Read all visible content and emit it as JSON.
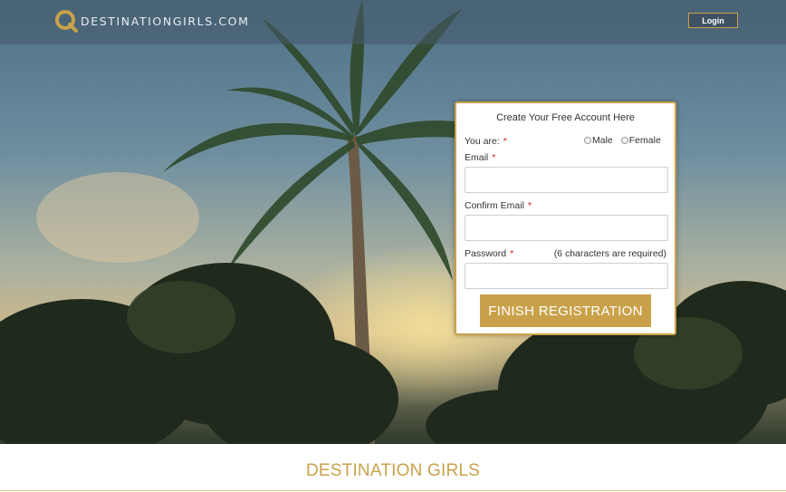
{
  "header": {
    "logo_text": "DESTINATIONGIRLS.COM",
    "login_label": "Login"
  },
  "form": {
    "title": "Create Your Free Account Here",
    "gender_label": "You are:",
    "gender_options": [
      "Male",
      "Female"
    ],
    "email_label": "Email",
    "confirm_email_label": "Confirm Email",
    "password_label": "Password",
    "password_note": "(6 characters are required)",
    "required_marker": "*",
    "email_value": "",
    "confirm_email_value": "",
    "password_value": "",
    "submit_label": "FINISH REGISTRATION"
  },
  "footer": {
    "title": "DESTINATION GIRLS"
  },
  "colors": {
    "accent": "#c9a14a",
    "required": "#d01c1c"
  }
}
